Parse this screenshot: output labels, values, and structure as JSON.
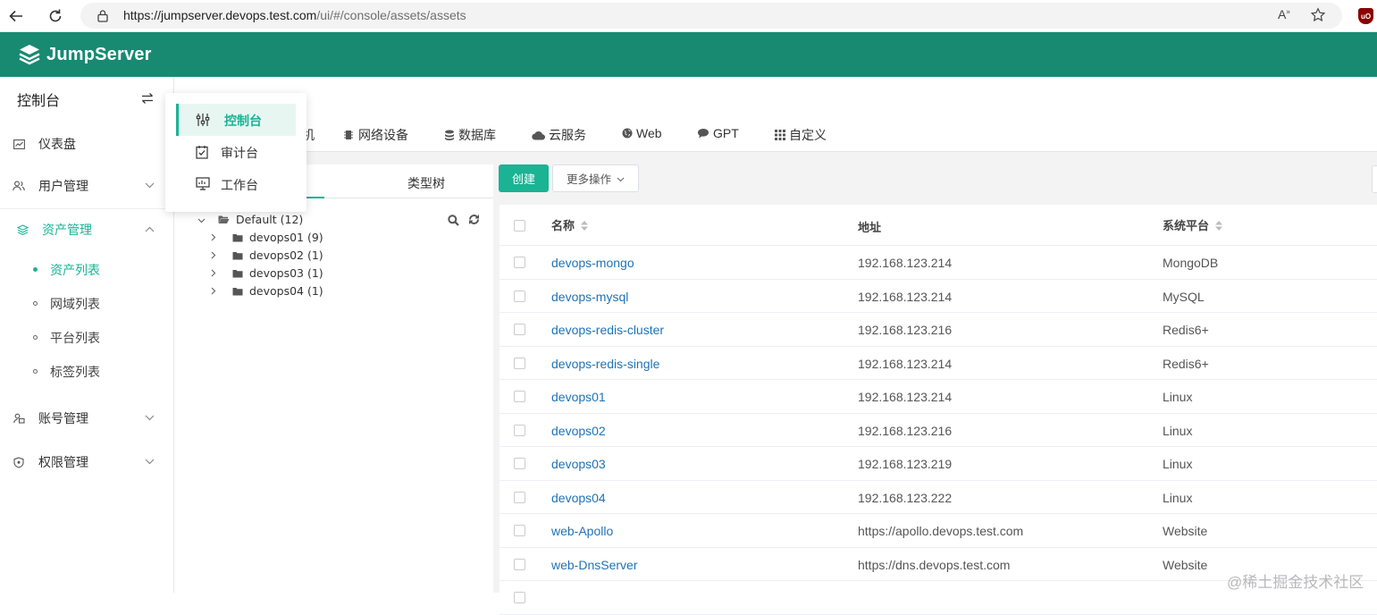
{
  "browser": {
    "url_host": "https://jumpserver.devops.test.com",
    "url_path": "/ui/#/console/assets/assets",
    "read_aloud": "A",
    "extension_badge": "uO"
  },
  "app": {
    "logo_text": "JumpServer"
  },
  "sidebar": {
    "title": "控制台",
    "items": [
      {
        "label": "仪表盘"
      },
      {
        "label": "用户管理"
      },
      {
        "label": "资产管理"
      },
      {
        "label": "账号管理"
      },
      {
        "label": "权限管理"
      }
    ],
    "sub_items": [
      {
        "label": "资产列表"
      },
      {
        "label": "网域列表"
      },
      {
        "label": "平台列表"
      },
      {
        "label": "标签列表"
      }
    ]
  },
  "switcher": {
    "items": [
      {
        "label": "控制台"
      },
      {
        "label": "审计台"
      },
      {
        "label": "工作台"
      }
    ]
  },
  "tabs": [
    {
      "label": "网络设备"
    },
    {
      "label": "数据库"
    },
    {
      "label": "云服务"
    },
    {
      "label": "Web"
    },
    {
      "label": "GPT"
    },
    {
      "label": "自定义"
    }
  ],
  "tree": {
    "tab_label": "类型树",
    "root": "Default (12)",
    "children": [
      "devops01 (9)",
      "devops02 (1)",
      "devops03 (1)",
      "devops04 (1)"
    ]
  },
  "actions": {
    "create": "创建",
    "more": "更多操作"
  },
  "table": {
    "headers": {
      "name": "名称",
      "address": "地址",
      "platform": "系统平台"
    },
    "rows": [
      {
        "name": "devops-mongo",
        "address": "192.168.123.214",
        "platform": "MongoDB"
      },
      {
        "name": "devops-mysql",
        "address": "192.168.123.214",
        "platform": "MySQL"
      },
      {
        "name": "devops-redis-cluster",
        "address": "192.168.123.216",
        "platform": "Redis6+"
      },
      {
        "name": "devops-redis-single",
        "address": "192.168.123.214",
        "platform": "Redis6+"
      },
      {
        "name": "devops01",
        "address": "192.168.123.214",
        "platform": "Linux"
      },
      {
        "name": "devops02",
        "address": "192.168.123.216",
        "platform": "Linux"
      },
      {
        "name": "devops03",
        "address": "192.168.123.219",
        "platform": "Linux"
      },
      {
        "name": "devops04",
        "address": "192.168.123.222",
        "platform": "Linux"
      },
      {
        "name": "web-Apollo",
        "address": "https://apollo.devops.test.com",
        "platform": "Website"
      },
      {
        "name": "web-DnsServer",
        "address": "https://dns.devops.test.com",
        "platform": "Website"
      }
    ]
  },
  "watermark": "@稀土掘金技术社区",
  "colors": {
    "brand": "#188a72",
    "accent": "#1ab394",
    "link": "#1f73b7"
  }
}
